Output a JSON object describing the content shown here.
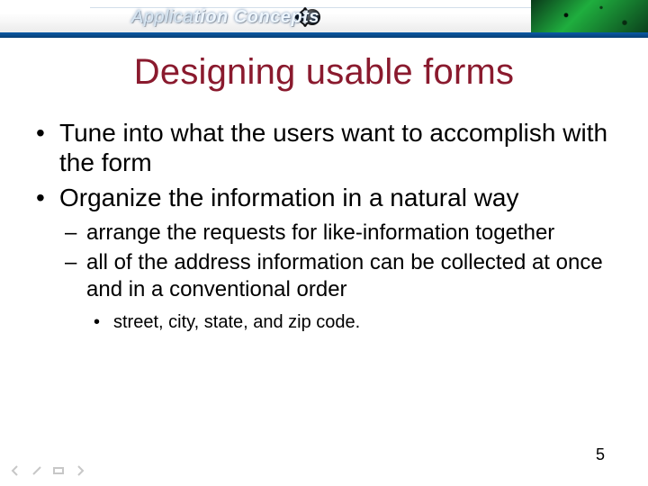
{
  "banner": {
    "text_prefix": "Applica",
    "text_emph": "tion Concepts"
  },
  "title": "Designing usable forms",
  "bullets": [
    {
      "text": "Tune into what the users want to accomplish with the form"
    },
    {
      "text": "Organize the information in a natural way",
      "children": [
        {
          "text": "arrange the requests for like-information together"
        },
        {
          "text": "all of the address information can be collected at once and in a conventional order",
          "children": [
            {
              "text": "street, city, state, and zip code."
            }
          ]
        }
      ]
    }
  ],
  "page_number": "5"
}
